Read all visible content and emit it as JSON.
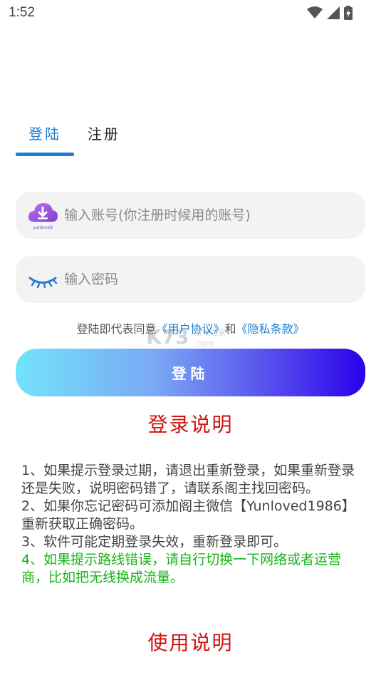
{
  "status_bar": {
    "time": "1:52"
  },
  "tabs": {
    "login": "登陆",
    "register": "注册"
  },
  "account_field": {
    "placeholder": "输入账号(你注册时候用的账号)",
    "icon_caption": "yunloved"
  },
  "password_field": {
    "placeholder": "输入密码"
  },
  "agreement": {
    "prefix": "登陆即代表同意",
    "user_agreement": "《用户协议》",
    "connector": "和",
    "privacy_policy": "《隐私条款》"
  },
  "login_button": {
    "label": "登陆"
  },
  "login_info": {
    "title": "登录说明",
    "items": [
      "1、如果提示登录过期，请退出重新登录，如果重新登录还是失败，说明密码错了，请联系阁主找回密码。",
      "2、如果你忘记密码可添加阁主微信【Yunloved1986】重新获取正确密码。",
      "3、软件可能定期登录失效，重新登录即可。",
      "4、如果提示路线错误，请自行切换一下网络或者运营商，比如把无线换成流量。"
    ]
  },
  "usage_info": {
    "title": "使用说明"
  },
  "watermark": {
    "text": "K73",
    "sub": "游戏之家",
    "domain": ".com"
  },
  "colors": {
    "accent": "#1a7fd4",
    "title_red": "#d21212",
    "tip_green": "#18b418"
  }
}
